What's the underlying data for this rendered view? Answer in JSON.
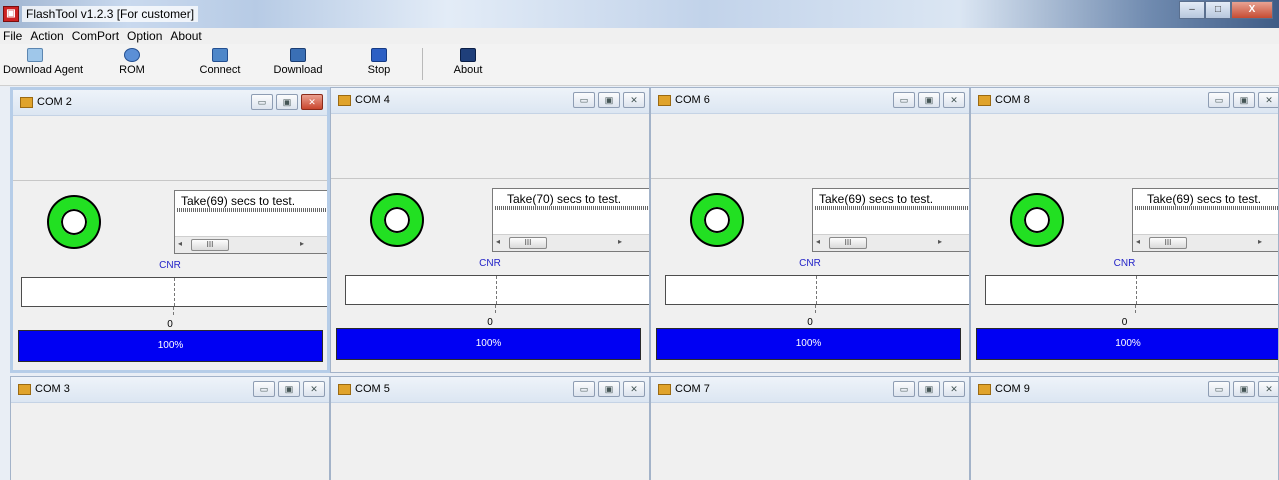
{
  "window": {
    "title": "FlashTool v1.2.3 [For customer]",
    "controls": {
      "minimize": "–",
      "maximize": "□",
      "close": "X"
    }
  },
  "menu": [
    "File",
    "Action",
    "ComPort",
    "Option",
    "About"
  ],
  "toolbar": [
    {
      "label": "Download Agent",
      "icon": "folder-icon",
      "color": "#9fc7ea"
    },
    {
      "label": "ROM",
      "icon": "globe-icon",
      "color": "#5b8fd6"
    },
    {
      "label": "Connect",
      "icon": "connect-icon",
      "color": "#4e87c9"
    },
    {
      "label": "Download",
      "icon": "download-icon",
      "color": "#3a6fb5"
    },
    {
      "label": "Stop",
      "icon": "stop-icon",
      "color": "#2c5fc4"
    },
    {
      "label": "About",
      "icon": "about-icon",
      "color": "#1f3f7a"
    }
  ],
  "panels_top": [
    {
      "title": "COM 2",
      "log": "Take(69) secs to test.",
      "cnr": "CNR",
      "axis_tick": "0",
      "progress_label": "100%",
      "progress": 1.0
    },
    {
      "title": "COM 4",
      "log": "Take(70) secs to test.",
      "cnr": "CNR",
      "axis_tick": "0",
      "progress_label": "100%",
      "progress": 1.0
    },
    {
      "title": "COM 6",
      "log": "Take(69) secs to test.",
      "cnr": "CNR",
      "axis_tick": "0",
      "progress_label": "100%",
      "progress": 1.0
    },
    {
      "title": "COM 8",
      "log": "Take(69) secs to test.",
      "cnr": "CNR",
      "axis_tick": "0",
      "progress_label": "100%",
      "progress": 1.0
    }
  ],
  "panels_bottom": [
    {
      "title": "COM 3"
    },
    {
      "title": "COM 5"
    },
    {
      "title": "COM 7"
    },
    {
      "title": "COM 9"
    }
  ],
  "panel_controls": {
    "minimize": "▭",
    "maximize": "▣",
    "close": "✕"
  },
  "scroll": {
    "left": "◂",
    "thumb": "III",
    "right": "▸"
  },
  "colors": {
    "progress": "#0000f3",
    "ring": "#22e022",
    "cnr_text": "#2323c8"
  }
}
